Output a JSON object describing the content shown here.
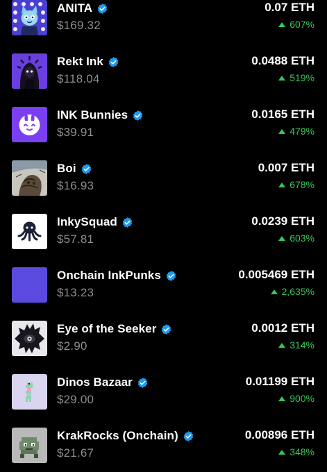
{
  "colors": {
    "background": "#000000",
    "text_primary": "#ffffff",
    "text_secondary": "#8e8e93",
    "positive": "#35c759",
    "verified": "#1d9bf0"
  },
  "collections": [
    {
      "name": "ANITA",
      "usd": "$169.32",
      "eth": "0.07 ETH",
      "change": "607%",
      "verified": true,
      "thumb_icon": "anita-avatar-icon"
    },
    {
      "name": "Rekt Ink",
      "usd": "$118.04",
      "eth": "0.0488 ETH",
      "change": "519%",
      "verified": true,
      "thumb_icon": "hooded-figure-icon"
    },
    {
      "name": "INK Bunnies",
      "usd": "$39.91",
      "eth": "0.0165 ETH",
      "change": "479%",
      "verified": true,
      "thumb_icon": "bunny-face-icon"
    },
    {
      "name": "Boi",
      "usd": "$16.93",
      "eth": "0.007 ETH",
      "change": "678%",
      "verified": true,
      "thumb_icon": "sketch-art-icon"
    },
    {
      "name": "InkySquad",
      "usd": "$57.81",
      "eth": "0.0239 ETH",
      "change": "603%",
      "verified": true,
      "thumb_icon": "octopus-icon"
    },
    {
      "name": "Onchain InkPunks",
      "usd": "$13.23",
      "eth": "0.005469 ETH",
      "change": "2,635%",
      "verified": true,
      "thumb_icon": "purple-square-icon"
    },
    {
      "name": "Eye of the Seeker",
      "usd": "$2.90",
      "eth": "0.0012 ETH",
      "change": "314%",
      "verified": true,
      "thumb_icon": "spiked-eye-icon"
    },
    {
      "name": "Dinos Bazaar",
      "usd": "$29.00",
      "eth": "0.01199 ETH",
      "change": "900%",
      "verified": true,
      "thumb_icon": "pixel-dino-icon"
    },
    {
      "name": "KrakRocks (Onchain)",
      "usd": "$21.67",
      "eth": "0.00896 ETH",
      "change": "348%",
      "verified": true,
      "thumb_icon": "pixel-rock-icon"
    }
  ]
}
